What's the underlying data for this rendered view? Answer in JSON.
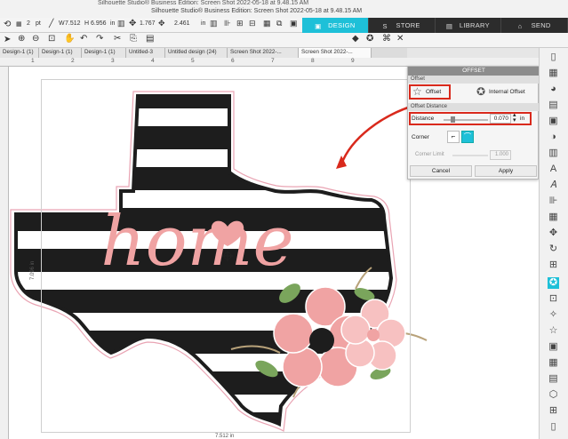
{
  "window": {
    "title_top": "Silhouette Studio® Business Edition: Screen Shot 2022-05-18 at 9.48.15 AM",
    "title_second": "Silhouette Studio® Business Edition: Screen Shot 2022-05-18 at 9.48.15 AM"
  },
  "nav_tabs": [
    {
      "label": "DESIGN",
      "active": true
    },
    {
      "label": "STORE",
      "active": false
    },
    {
      "label": "LIBRARY",
      "active": false
    },
    {
      "label": "SEND",
      "active": false
    }
  ],
  "toolbar": {
    "line_unit": "pt",
    "width_label": "W",
    "width_value": "7.512",
    "height_label": "H",
    "height_value": "6.956",
    "size_unit": "in",
    "x_value": "1.767",
    "y_value": "2.461",
    "pos_unit": "in"
  },
  "doc_tabs": [
    {
      "label": "Design-1 (1)",
      "active": false
    },
    {
      "label": "Design-1 (1)",
      "active": false
    },
    {
      "label": "Design-1 (1)",
      "active": false
    },
    {
      "label": "Untitled-3",
      "active": false
    },
    {
      "label": "Untitled design (24)",
      "active": false
    },
    {
      "label": "Screen Shot 2022-...",
      "active": false
    },
    {
      "label": "Screen Shot 2022-...",
      "active": true
    }
  ],
  "ruler_top_numbers": [
    "1",
    "2",
    "3",
    "4",
    "5",
    "6",
    "7",
    "8",
    "9"
  ],
  "dimensions": {
    "height_label": "7.096 in",
    "width_label": "7.512 in"
  },
  "design": {
    "word": "home",
    "stripe_color": "#1d1d1d",
    "text_color": "#f0a3a3",
    "flower_color": "#f0a3a3",
    "leaf_color": "#7aa55c",
    "branch_color": "#b8a27a"
  },
  "offset_panel": {
    "title": "OFFSET",
    "section_offset": "Offset",
    "offset_option": "Offset",
    "internal_offset_option": "Internal Offset",
    "section_distance": "Offset Distance",
    "distance_label": "Distance",
    "distance_value": "0.070",
    "distance_unit": "in",
    "corner_label": "Corner",
    "corner_limit_label": "Corner Limit",
    "corner_limit_value": "1.000",
    "cancel_label": "Cancel",
    "apply_label": "Apply"
  },
  "colors": {
    "accent": "#1ec0d8",
    "annotation_red": "#d9291c"
  }
}
